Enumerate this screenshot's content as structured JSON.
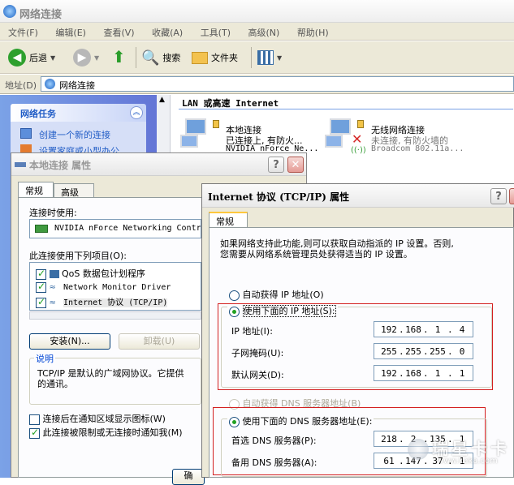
{
  "explorer": {
    "title": "网络连接",
    "menu": [
      "文件(F)",
      "编辑(E)",
      "查看(V)",
      "收藏(A)",
      "工具(T)",
      "高级(N)",
      "帮助(H)"
    ],
    "toolbar": {
      "back": "后退",
      "search": "搜索",
      "folders": "文件夹"
    },
    "address_label": "地址(D)",
    "address_value": "网络连接",
    "task_pane": {
      "title": "网络任务",
      "items": [
        "创建一个新的连接",
        "设置家庭或小型办公"
      ]
    },
    "group_header": "LAN 或高速 Internet",
    "connections": [
      {
        "name": "本地连接",
        "status": "已连接上, 有防火...",
        "device": "NVIDIA nForce Ne..."
      },
      {
        "name": "无线网络连接",
        "status": "未连接, 有防火墙的",
        "device": "Broadcom 802.11a..."
      }
    ]
  },
  "local_dialog": {
    "title": "本地连接 属性",
    "tabs": [
      "常规",
      "高级"
    ],
    "connect_using_label": "连接时使用:",
    "adapter": "NVIDIA nForce Networking Contr",
    "items_label": "此连接使用下列项目(O):",
    "items": [
      {
        "label": "QoS 数据包计划程序",
        "checked": true
      },
      {
        "label": "Network Monitor Driver",
        "checked": true
      },
      {
        "label": "Internet 协议 (TCP/IP)",
        "checked": true
      }
    ],
    "install_button": "安装(N)...",
    "uninstall_button": "卸载(U)",
    "description_label": "说明",
    "description_line1": "TCP/IP 是默认的广域网协议。它提供",
    "description_line2": "的通讯。",
    "option1": {
      "label": "连接后在通知区域显示图标(W)",
      "checked": false
    },
    "option2": {
      "label": "此连接被限制或无连接时通知我(M)",
      "checked": true
    },
    "ok_button": "确"
  },
  "tcpip_dialog": {
    "title": "Internet 协议 (TCP/IP) 属性",
    "tab": "常规",
    "intro_line1": "如果网络支持此功能,则可以获取自动指派的 IP 设置。否则,",
    "intro_line2": "您需要从网络系统管理员处获得适当的 IP 设置。",
    "auto_ip_label": "自动获得 IP 地址(O)",
    "manual_ip_label": "使用下面的 IP 地址(S):",
    "ip_label": "IP 地址(I):",
    "ip_value": [
      "192",
      "168",
      "1",
      "4"
    ],
    "mask_label": "子网掩码(U):",
    "mask_value": [
      "255",
      "255",
      "255",
      "0"
    ],
    "gateway_label": "默认网关(D):",
    "gateway_value": [
      "192",
      "168",
      "1",
      "1"
    ],
    "auto_dns_label": "自动获得 DNS 服务器地址(B)",
    "manual_dns_label": "使用下面的 DNS 服务器地址(E):",
    "pref_dns_label": "首选 DNS 服务器(P):",
    "pref_dns_value": [
      "218",
      "2",
      "135",
      "1"
    ],
    "alt_dns_label": "备用 DNS 服务器(A):",
    "alt_dns_value": [
      "61",
      "147",
      "37",
      "1"
    ]
  },
  "watermark": {
    "text": "瑞星卡卡",
    "url": "www.kaka.com"
  },
  "colors": {
    "highlight_box": "#d32020",
    "task_pane": "#6f8ee0"
  }
}
